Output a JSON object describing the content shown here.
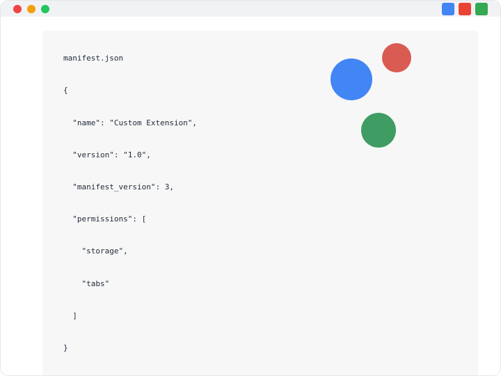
{
  "colors": {
    "blue": "#4285f4",
    "red": "#ea4335",
    "green": "#34a853",
    "red_muted": "#d95b52",
    "green_muted": "#3f9c63"
  },
  "code": {
    "filename": "manifest.json",
    "line_open": "{",
    "line_name": "  \"name\": \"Custom Extension\",",
    "line_version": "  \"version\": \"1.0\",",
    "line_manifest_version": "  \"manifest_version\": 3,",
    "line_permissions_open": "  \"permissions\": [",
    "line_perm_storage": "    \"storage\",",
    "line_perm_tabs": "    \"tabs\"",
    "line_permissions_close": "  ]",
    "line_close": "}"
  }
}
